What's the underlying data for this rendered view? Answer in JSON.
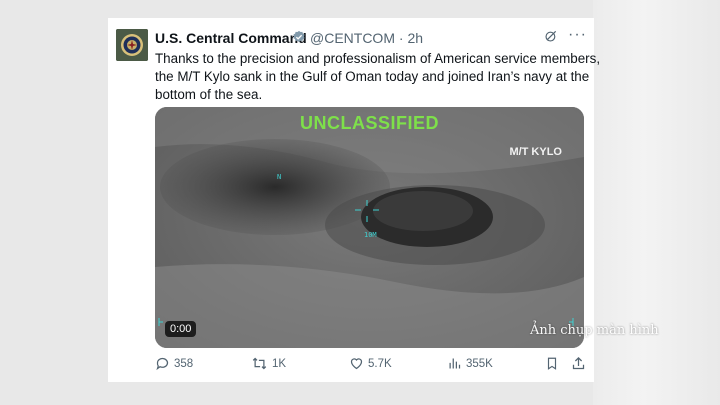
{
  "author": {
    "name": "U.S. Central Command",
    "handle": "@CENTCOM",
    "time": "2h",
    "avatar_icon": "centcom-seal-icon"
  },
  "tweet": {
    "lines": [
      "Thanks to the precision and professionalism of American service members,",
      "the M/T Kylo sank in the Gulf of Oman today and joined Iran’s navy at the",
      "bottom of the sea."
    ]
  },
  "media": {
    "banner": "UNCLASSIFIED",
    "vessel_label": "M/T KYLO",
    "north_marker": "N",
    "range_label": "10M",
    "timestamp": "0:00",
    "banner_color": "#7ee04a",
    "hud_color": "#3fd0d0"
  },
  "actions": {
    "replies": "358",
    "reposts": "1K",
    "likes": "5.7K",
    "views": "355K"
  },
  "watermark": "Ảnh chụp màn hình",
  "colors": {
    "text": "#0f1419",
    "secondary": "#536471",
    "verified": "#829aab"
  }
}
